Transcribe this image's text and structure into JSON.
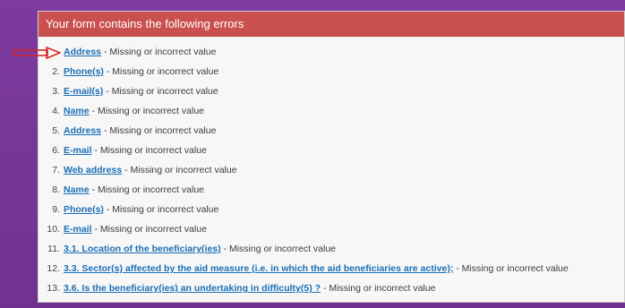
{
  "panel": {
    "title": "Your form contains the following errors"
  },
  "separator": "-",
  "message": "Missing or incorrect value",
  "errors": [
    {
      "num": "",
      "field": "Address"
    },
    {
      "num": "2.",
      "field": "Phone(s)"
    },
    {
      "num": "3.",
      "field": "E-mail(s)"
    },
    {
      "num": "4.",
      "field": "Name"
    },
    {
      "num": "5.",
      "field": "Address"
    },
    {
      "num": "6.",
      "field": "E-mail"
    },
    {
      "num": "7.",
      "field": "Web address"
    },
    {
      "num": "8.",
      "field": "Name"
    },
    {
      "num": "9.",
      "field": "Phone(s)"
    },
    {
      "num": "10.",
      "field": "E-mail"
    },
    {
      "num": "11.",
      "field": "3.1. Location of the beneficiary(ies)"
    },
    {
      "num": "12.",
      "field": "3.3. Sector(s) affected by the aid measure (i.e. in which the aid beneficiaries are active);"
    },
    {
      "num": "13.",
      "field": "3.6. Is the beneficiary(ies) an undertaking in difficulty(5) ?"
    }
  ],
  "colors": {
    "header": "#c9504f",
    "link": "#1b6fb6",
    "arrow": "#d9262a",
    "background": "#7a3a9a"
  }
}
